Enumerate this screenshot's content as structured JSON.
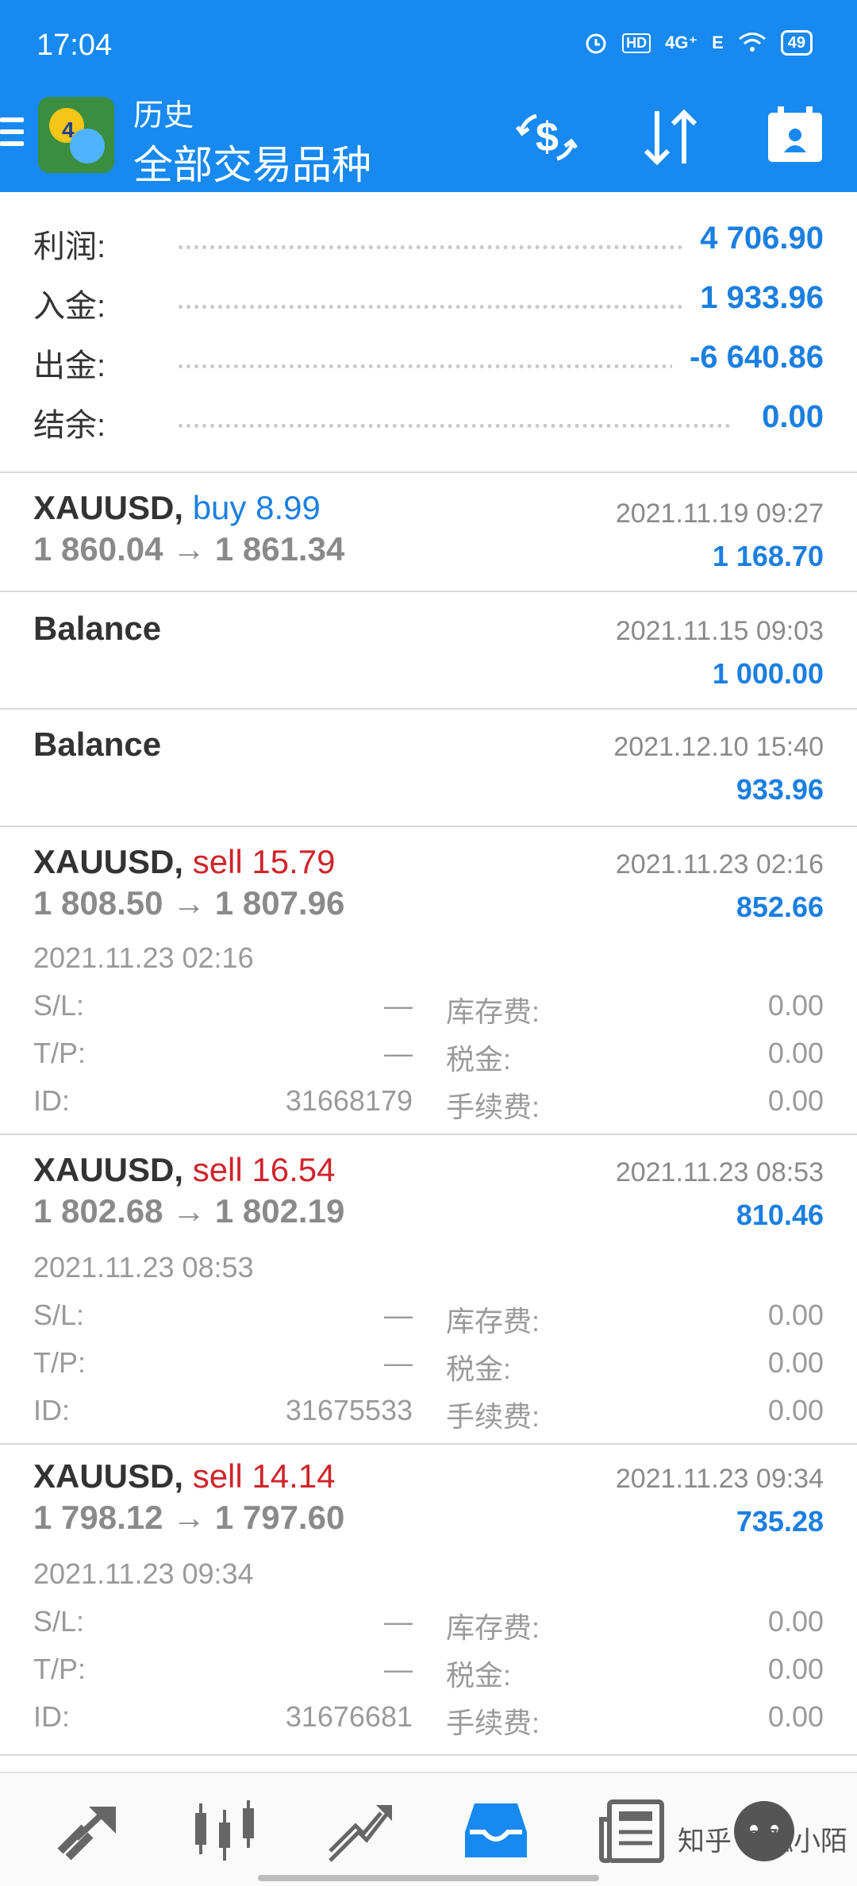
{
  "status_bar": {
    "time": "17:04",
    "signal_4g": "4G⁺",
    "signal_e": "E",
    "battery": "49"
  },
  "header": {
    "subtitle": "历史",
    "title": "全部交易品种",
    "icons": [
      "menu-icon",
      "app-logo",
      "currency-swap-icon",
      "sort-icon",
      "calendar-icon"
    ]
  },
  "summary": [
    {
      "label": "利润:",
      "value": "4 706.90"
    },
    {
      "label": "入金:",
      "value": "1 933.96"
    },
    {
      "label": "出金:",
      "value": "-6 640.86"
    },
    {
      "label": "结余:",
      "value": "0.00"
    }
  ],
  "entries": [
    {
      "symbol": "XAUUSD,",
      "type": "buy 8.99",
      "prices": "1 860.04 → 1 861.34",
      "date": "2021.11.19 09:27",
      "profit": "1 168.70"
    },
    {
      "symbol": "Balance",
      "date": "2021.11.15 09:03",
      "profit": "1 000.00"
    },
    {
      "symbol": "Balance",
      "date": "2021.12.10 15:40",
      "profit": "933.96"
    },
    {
      "symbol": "XAUUSD,",
      "type": "sell 15.79",
      "prices": "1 808.50 → 1 807.96",
      "date": "2021.11.23 02:16",
      "profit": "852.66",
      "open_time": "2021.11.23 02:16",
      "sl_label": "S/L:",
      "sl": "—",
      "tp_label": "T/P:",
      "tp": "—",
      "id_label": "ID:",
      "id": "31668179",
      "swap_label": "库存费:",
      "swap": "0.00",
      "tax_label": "税金:",
      "tax": "0.00",
      "fee_label": "手续费:",
      "fee": "0.00"
    },
    {
      "symbol": "XAUUSD,",
      "type": "sell 16.54",
      "prices": "1 802.68 → 1 802.19",
      "date": "2021.11.23 08:53",
      "profit": "810.46",
      "open_time": "2021.11.23 08:53",
      "sl_label": "S/L:",
      "sl": "—",
      "tp_label": "T/P:",
      "tp": "—",
      "id_label": "ID:",
      "id": "31675533",
      "swap_label": "库存费:",
      "swap": "0.00",
      "tax_label": "税金:",
      "tax": "0.00",
      "fee_label": "手续费:",
      "fee": "0.00"
    },
    {
      "symbol": "XAUUSD,",
      "type": "sell 14.14",
      "prices": "1 798.12 → 1 797.60",
      "date": "2021.11.23 09:34",
      "profit": "735.28",
      "open_time": "2021.11.23 09:34",
      "sl_label": "S/L:",
      "sl": "—",
      "tp_label": "T/P:",
      "tp": "—",
      "id_label": "ID:",
      "id": "31676681",
      "swap_label": "库存费:",
      "swap": "0.00",
      "tax_label": "税金:",
      "tax": "0.00",
      "fee_label": "手续费:",
      "fee": "0.00"
    }
  ],
  "bottom_nav": {
    "items": [
      "quotes-icon",
      "chart-icon",
      "trade-icon",
      "history-icon",
      "news-icon",
      "messages-icon"
    ],
    "active": "history-icon"
  },
  "watermark": "知乎 @孤小陌",
  "colors": {
    "header_bg": "#1789f0",
    "profit_blue": "#1b7fe0",
    "sell_red": "#d0242b",
    "grey_text": "#8a8a8a"
  }
}
